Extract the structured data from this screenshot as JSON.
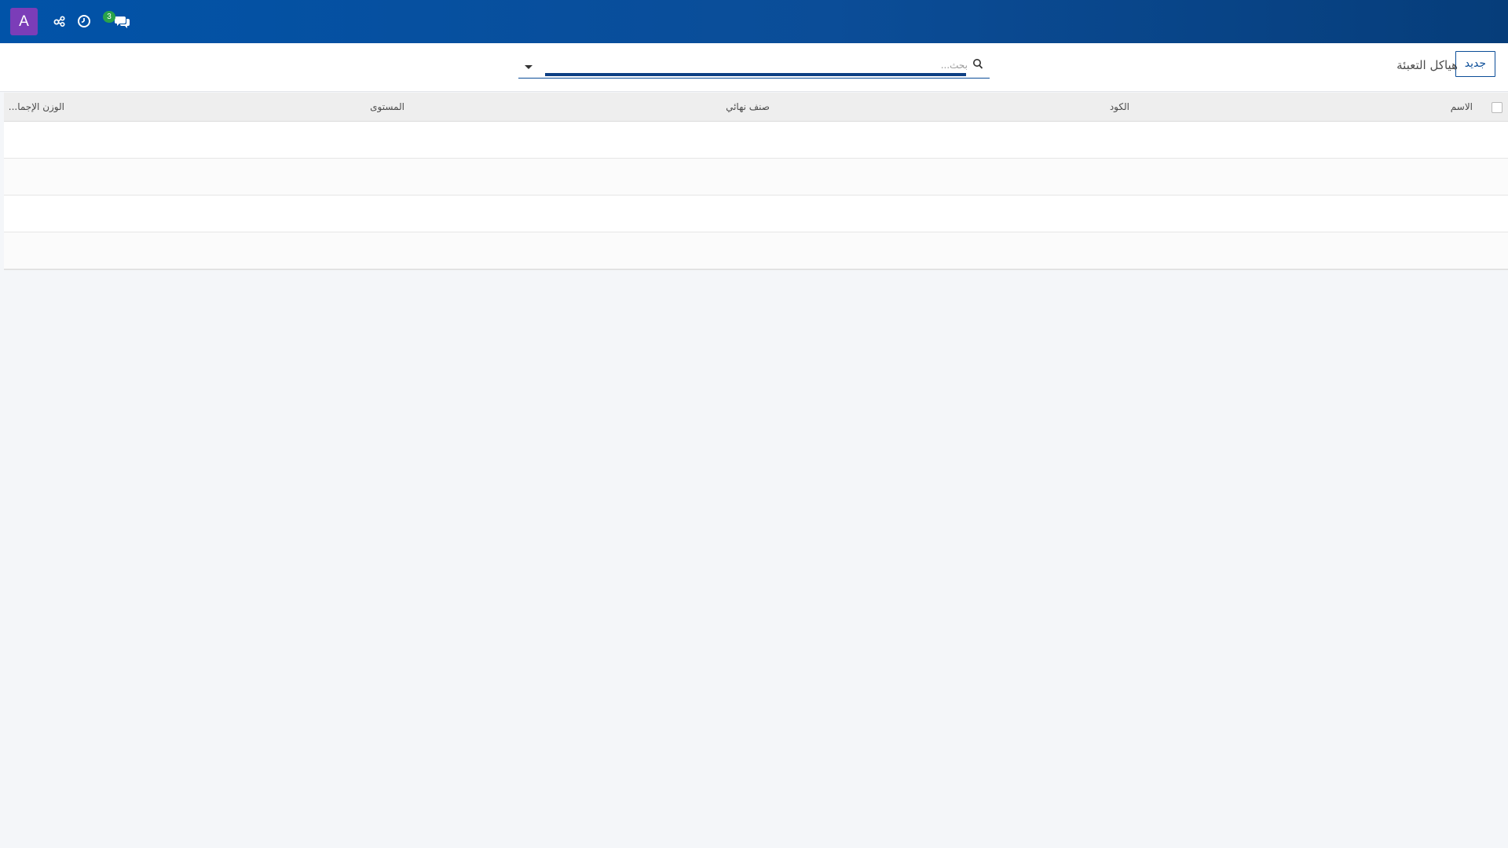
{
  "navbar": {
    "avatar_letter": "A",
    "avatar_color": "#7b3db8",
    "bg_color": "#0b4d98",
    "icons": [
      "share-alt-icon",
      "clock-icon",
      "chat-icon"
    ],
    "chat_badge_count": "3",
    "badge_color": "#2aa34a"
  },
  "control_panel": {
    "new_button_label": "جديد",
    "breadcrumb": "هياكل التعبئة",
    "search": {
      "placeholder": "بحث...",
      "value": ""
    }
  },
  "list": {
    "columns": [
      "الاسم",
      "الكود",
      "صنف نهائي",
      "المستوى",
      "الوزن الإجما..."
    ],
    "rows": [
      "",
      "",
      "",
      ""
    ]
  }
}
